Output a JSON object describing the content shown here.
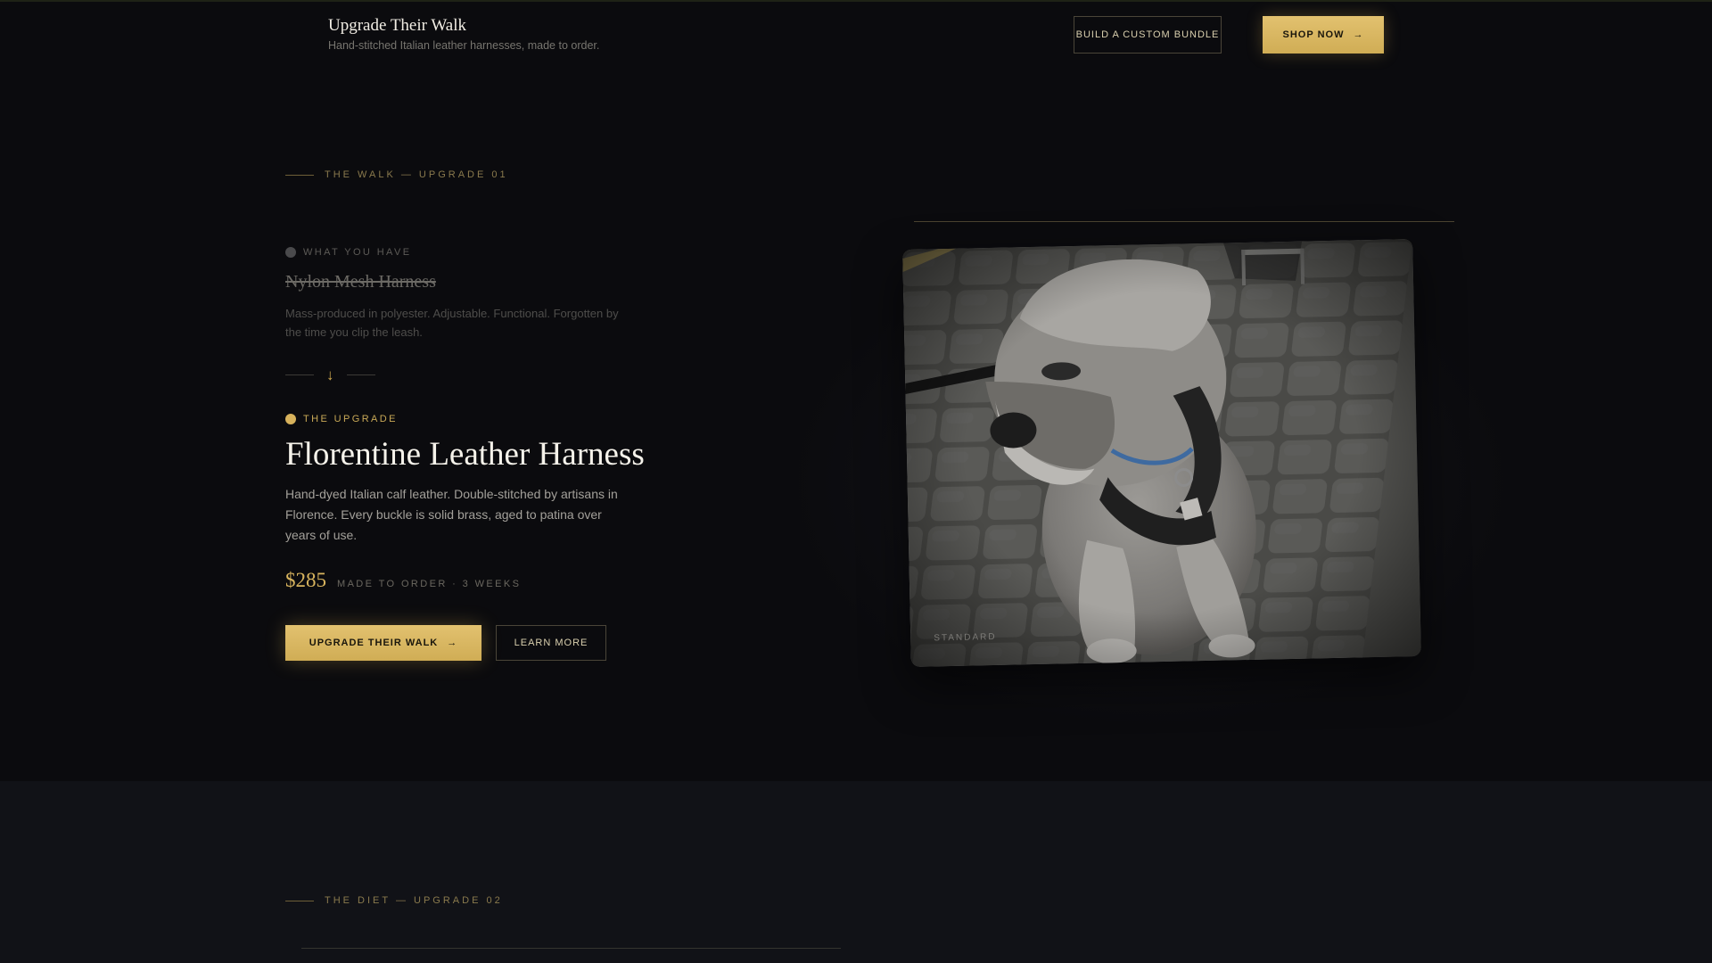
{
  "header": {
    "title": "Upgrade Their Walk",
    "tagline": "Hand-stitched Italian leather harnesses, made to order.",
    "bundle_button": "BUILD A CUSTOM BUNDLE",
    "shop_button": "SHOP NOW",
    "shop_arrow": "→"
  },
  "section1": {
    "eyebrow": "THE WALK — UPGRADE 01",
    "current": {
      "label": "WHAT YOU HAVE",
      "name": "Nylon Mesh Harness",
      "description": "Mass-produced in polyester. Adjustable. Functional. Forgotten by the time you clip the leash."
    },
    "divider_arrow": "↓",
    "upgrade": {
      "label": "THE UPGRADE",
      "name": "Florentine Leather Harness",
      "description": "Hand-dyed Italian calf leather. Double-stitched by artisans in Florence. Every buckle is solid brass, aged to patina over years of use.",
      "price": "$285",
      "price_note": "MADE TO ORDER · 3 WEEKS",
      "primary_button": "UPGRADE THEIR WALK",
      "primary_arrow": "→",
      "secondary_button": "LEARN MORE"
    },
    "image": {
      "caption": "STANDARD",
      "alt": "schnauzer wearing a harness on cobblestones"
    }
  },
  "section2": {
    "eyebrow": "THE DIET — UPGRADE 02"
  },
  "colors": {
    "background": "#0b0b0e",
    "gold": "#d8b45e",
    "section2_bg": "#111217"
  }
}
